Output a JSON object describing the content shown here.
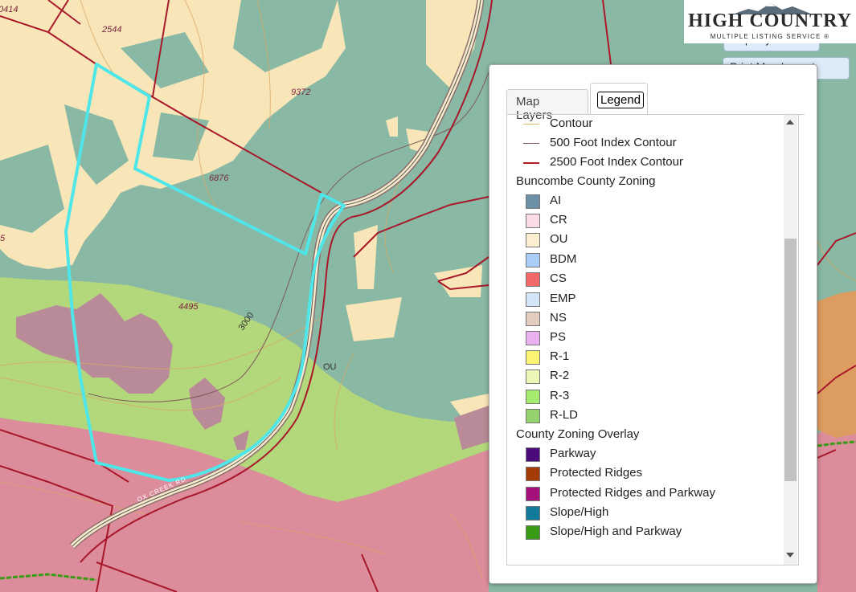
{
  "map": {
    "parcel_labels": [
      "0414",
      "2544",
      "9372",
      "6876",
      "4495",
      "5"
    ],
    "contour_label": "3000",
    "zone_label": "OU",
    "road_label": "OX CREEK RD",
    "colors": {
      "residential_pink": "#dc8c9b",
      "rld_green": "#b3d77b",
      "ou_tan": "#f8e6b8",
      "open_green": "#89b9a4",
      "ns_mauve": "#b98b98",
      "parcel_line": "#a8172a",
      "subject_outline": "#4ee6e8",
      "orange_zone": "#dd9c60"
    }
  },
  "logo": {
    "title": "HIGH COUNTRY",
    "subtitle": "MULTIPLE LISTING SERVICE ®"
  },
  "background_buttons": {
    "map_layers": "Map Layers",
    "print_map": "Print Map Layout"
  },
  "panel": {
    "tabs": [
      {
        "label": "Map Layers",
        "active": false
      },
      {
        "label": "Legend",
        "active": true
      }
    ],
    "line_items": [
      {
        "label": "Contour",
        "color": "#d7b86b"
      },
      {
        "label": "500 Foot Index Contour",
        "color": "#7e5a5a"
      },
      {
        "label": "2500 Foot Index Contour",
        "color": "#b11f24"
      }
    ],
    "buncombe_header": "Buncombe County Zoning",
    "zoning": [
      {
        "label": "AI",
        "color": "#6b90a8"
      },
      {
        "label": "CR",
        "color": "#fbdbe3"
      },
      {
        "label": "OU",
        "color": "#fcefcf"
      },
      {
        "label": "BDM",
        "color": "#a9cdf6"
      },
      {
        "label": "CS",
        "color": "#f16a6a"
      },
      {
        "label": "EMP",
        "color": "#d4e4f9"
      },
      {
        "label": "NS",
        "color": "#e3cdc0"
      },
      {
        "label": "PS",
        "color": "#ebb0f0"
      },
      {
        "label": "R-1",
        "color": "#fbf472"
      },
      {
        "label": "R-2",
        "color": "#eaf7b6"
      },
      {
        "label": "R-3",
        "color": "#a5eb70"
      },
      {
        "label": "R-LD",
        "color": "#94d26e"
      }
    ],
    "overlay_header": "County Zoning Overlay",
    "overlay": [
      {
        "label": "Parkway",
        "color": "#4d0a7a"
      },
      {
        "label": "Protected Ridges",
        "color": "#a63a06"
      },
      {
        "label": "Protected Ridges and Parkway",
        "color": "#a5107a"
      },
      {
        "label": "Slope/High",
        "color": "#0f7b98"
      },
      {
        "label": "Slope/High and Parkway",
        "color": "#3a9b17"
      }
    ]
  }
}
